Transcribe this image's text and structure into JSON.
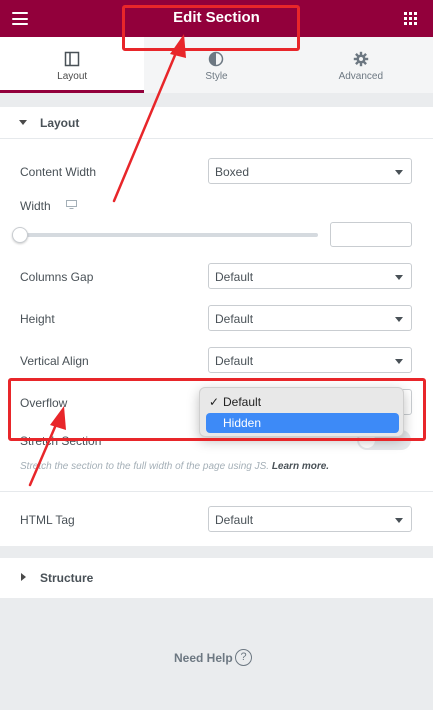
{
  "header": {
    "title": "Edit Section"
  },
  "tabs": [
    {
      "label": "Layout",
      "icon": "layout-columns-icon",
      "active": true
    },
    {
      "label": "Style",
      "icon": "half-circle-icon",
      "active": false
    },
    {
      "label": "Advanced",
      "icon": "gear-icon",
      "active": false
    }
  ],
  "layout_section": {
    "title": "Layout",
    "content_width": {
      "label": "Content Width",
      "value": "Boxed"
    },
    "width": {
      "label": "Width",
      "value": ""
    },
    "columns_gap": {
      "label": "Columns Gap",
      "value": "Default"
    },
    "height": {
      "label": "Height",
      "value": "Default"
    },
    "vertical_align": {
      "label": "Vertical Align",
      "value": "Default"
    },
    "overflow": {
      "label": "Overflow",
      "options": [
        "Default",
        "Hidden"
      ],
      "checked": "Default",
      "highlighted": "Hidden"
    },
    "stretch_section": {
      "label": "Stretch Section",
      "description": "Stretch the section to the full width of the page using JS.",
      "link": "Learn more."
    },
    "html_tag": {
      "label": "HTML Tag",
      "value": "Default"
    }
  },
  "structure_section": {
    "title": "Structure"
  },
  "footer": {
    "need_help": "Need Help",
    "help_symbol": "?"
  },
  "colors": {
    "brand": "#92003b",
    "annotation": "#e8262a",
    "selection": "#3d8af7"
  }
}
